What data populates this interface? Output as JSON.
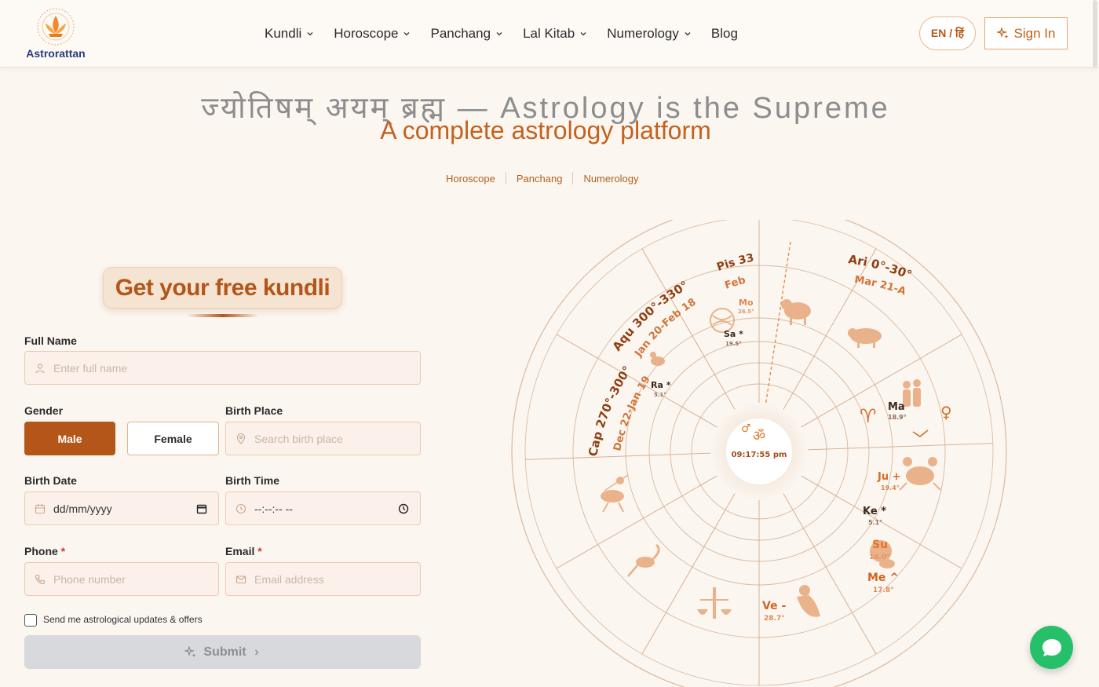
{
  "brand": {
    "name": "Astrorattan"
  },
  "nav": {
    "items": [
      {
        "label": "Kundli",
        "has_dropdown": true
      },
      {
        "label": "Horoscope",
        "has_dropdown": true
      },
      {
        "label": "Panchang",
        "has_dropdown": true
      },
      {
        "label": "Lal Kitab",
        "has_dropdown": true
      },
      {
        "label": "Numerology",
        "has_dropdown": true
      },
      {
        "label": "Blog",
        "has_dropdown": false
      }
    ]
  },
  "header": {
    "lang_label": "EN / हिं",
    "signin_label": "Sign In"
  },
  "hero": {
    "title": "ज्योतिषम् अयम् ब्रह्म — Astrology is the Supreme",
    "subtitle": "A complete astrology platform",
    "quick_links": [
      "Horoscope",
      "Panchang",
      "Numerology"
    ]
  },
  "form": {
    "cta": "Get your free kundli",
    "full_name": {
      "label": "Full Name",
      "placeholder": "Enter full name"
    },
    "gender": {
      "label": "Gender",
      "options": [
        "Male",
        "Female"
      ],
      "selected": "Male"
    },
    "birth_place": {
      "label": "Birth Place",
      "placeholder": "Search birth place"
    },
    "birth_date": {
      "label": "Birth Date",
      "value": "dd/mm/yyyy"
    },
    "birth_time": {
      "label": "Birth Time",
      "value": "--:--:-- --"
    },
    "phone": {
      "label": "Phone",
      "required_mark": "*",
      "placeholder": "Phone number"
    },
    "email": {
      "label": "Email",
      "required_mark": "*",
      "placeholder": "Email address"
    },
    "consent": "Send me astrological updates & offers",
    "submit": "Submit"
  },
  "wheel": {
    "center_symbol": "ॐ",
    "time": "09:17:55 pm",
    "sign_labels": [
      {
        "sign": "Ari 0°-30°",
        "dates": "Mar 21-A"
      },
      {
        "sign": "Pis 33",
        "dates": "Feb"
      },
      {
        "sign": "Aqu 300°-330°",
        "dates": "Jan 20-Feb 18"
      },
      {
        "sign": "Cap 270°-300°",
        "dates": "Dec 22-Jan 19"
      }
    ],
    "planets": [
      {
        "abbr": "Mo",
        "degree": "26.5°"
      },
      {
        "abbr": "Sa *",
        "degree": "19.5°"
      },
      {
        "abbr": "Ra *",
        "degree": "5.1°"
      },
      {
        "abbr": "Ma",
        "degree": "18.9°"
      },
      {
        "abbr": "Ju +",
        "degree": "19.4°"
      },
      {
        "abbr": "Ke *",
        "degree": "5.1°"
      },
      {
        "abbr": "Su",
        "degree": "14.0°"
      },
      {
        "abbr": "Me ^",
        "degree": "17.8°"
      },
      {
        "abbr": "Ve -",
        "degree": "28.7°"
      }
    ],
    "glyphs": {
      "mars": "♂",
      "venus": "♀",
      "aries": "♈"
    }
  },
  "colors": {
    "accent": "#b4561a",
    "chat": "#26c06a",
    "background": "#fbf6f0"
  }
}
